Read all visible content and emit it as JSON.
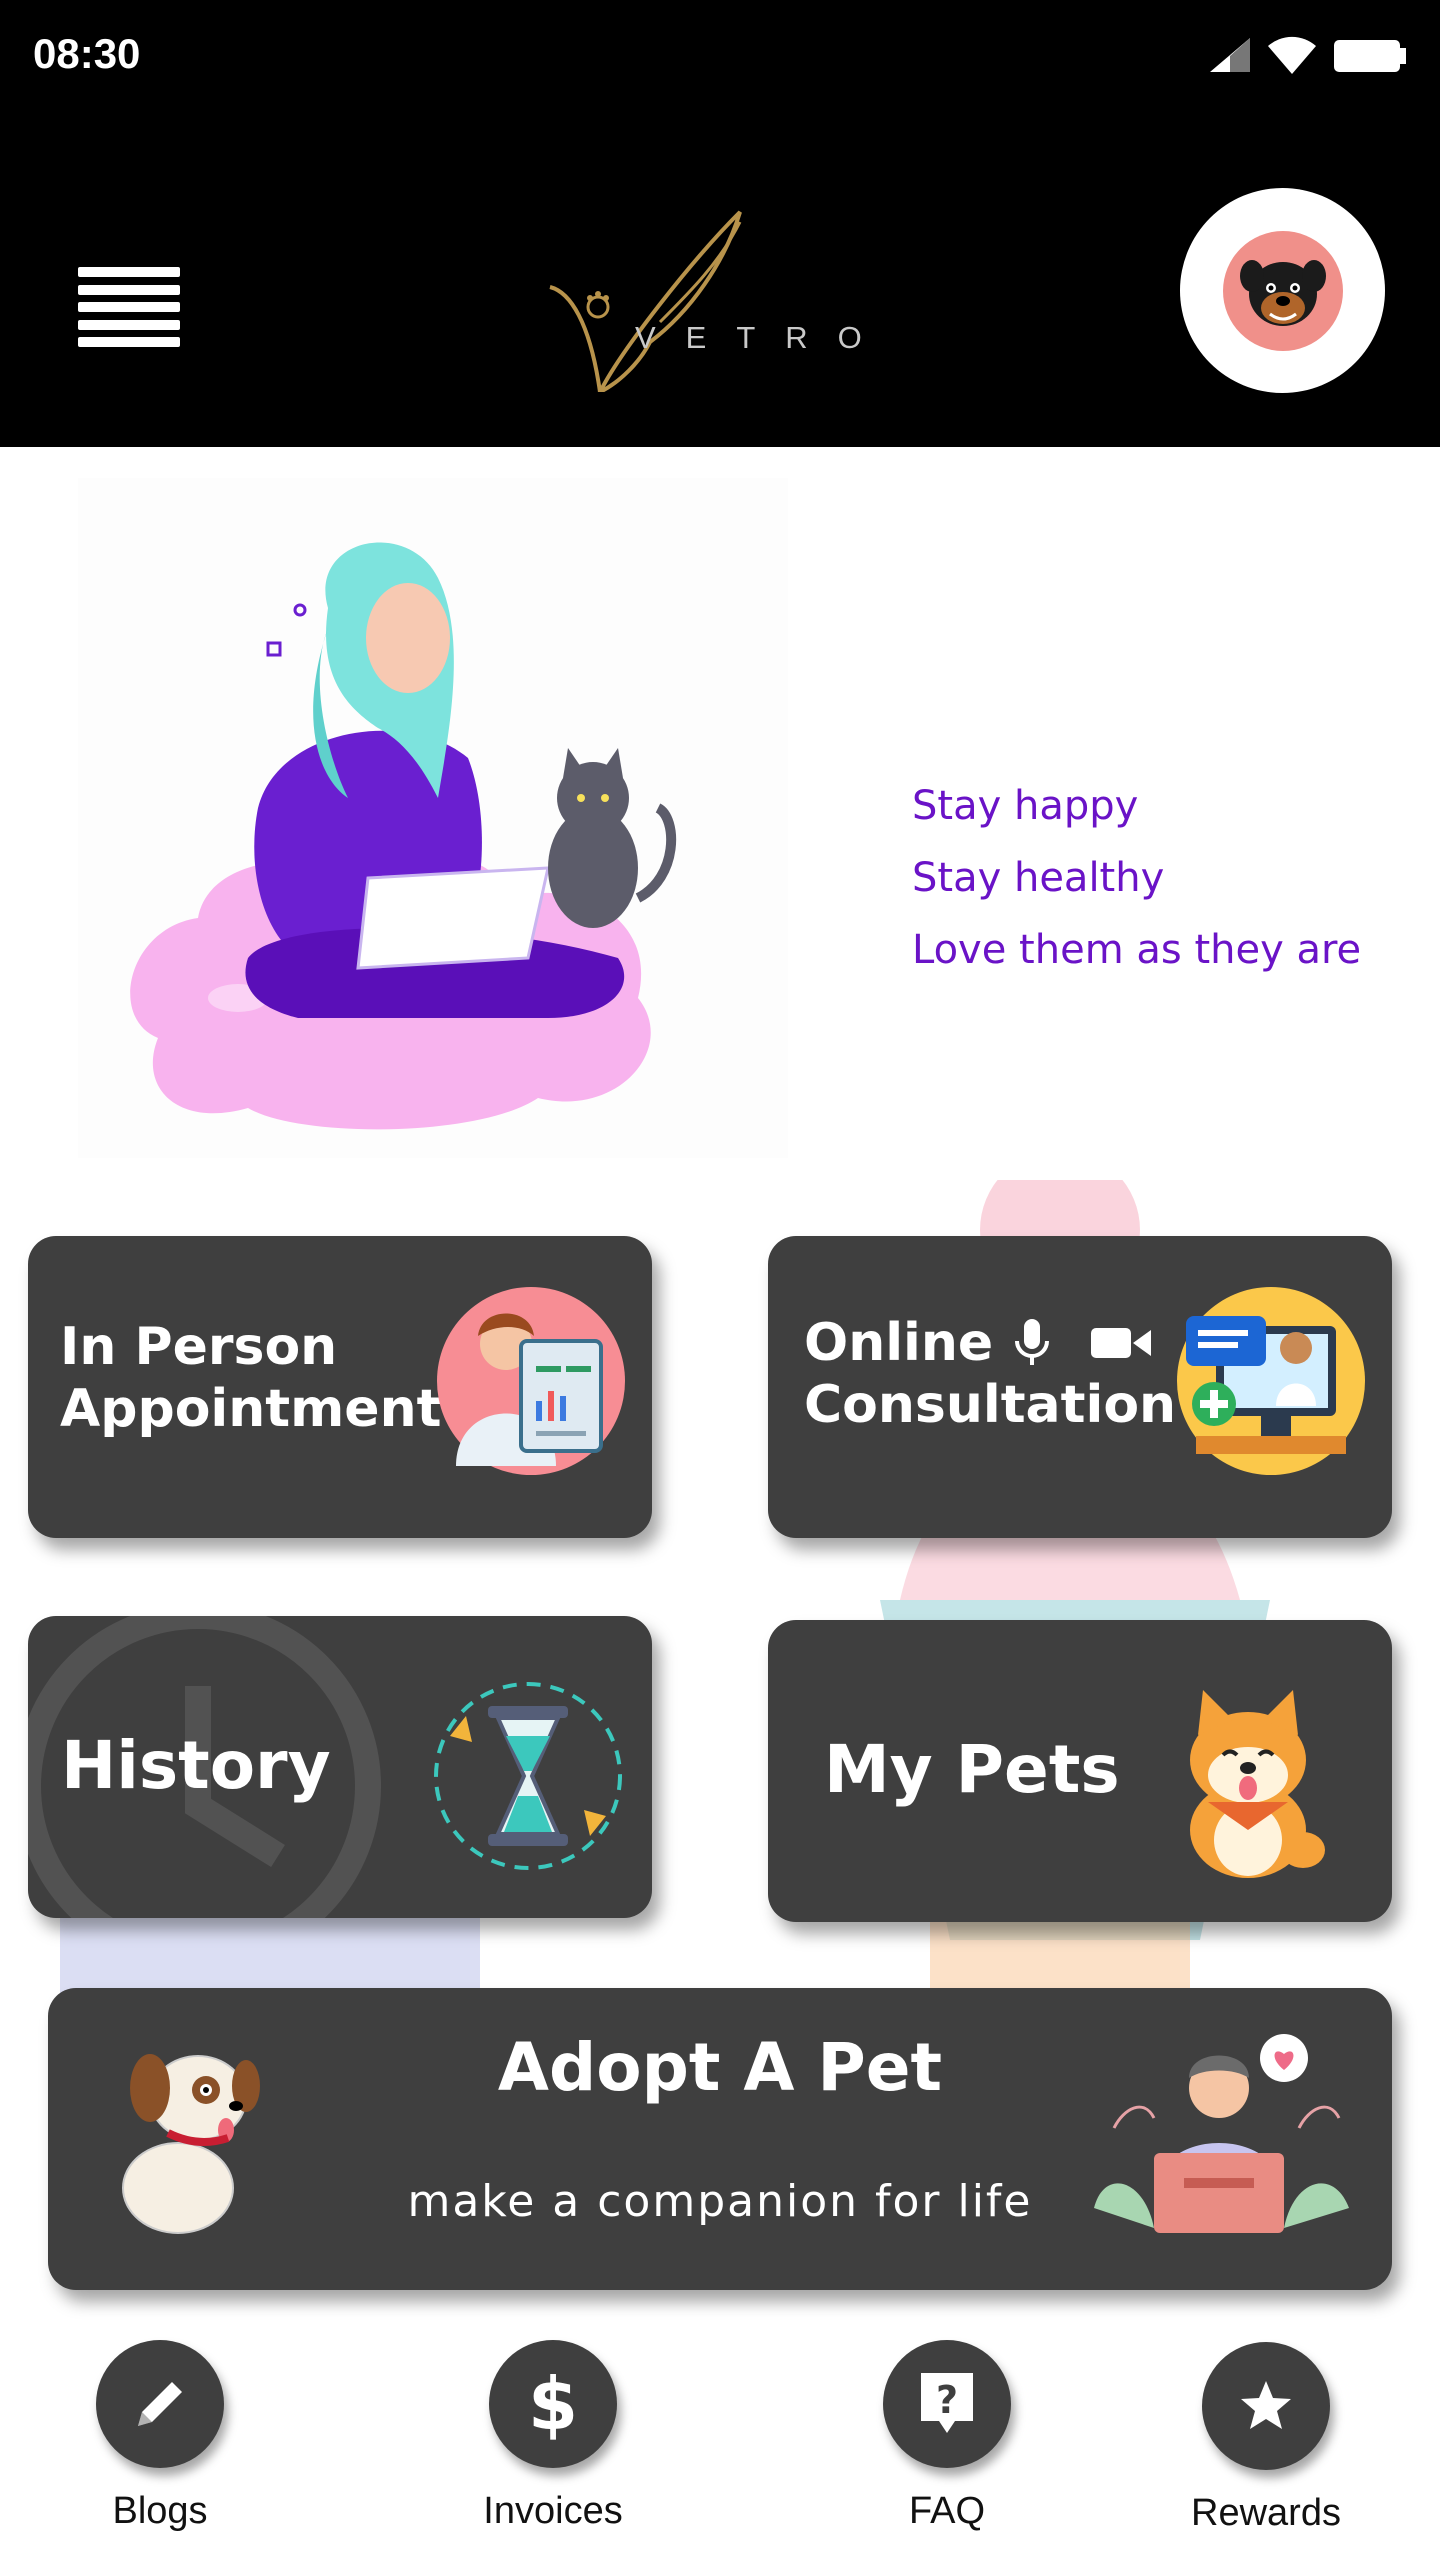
{
  "status": {
    "time": "08:30"
  },
  "header": {
    "logo_text": "VETRO"
  },
  "hero": {
    "tagline": [
      "Stay happy",
      "Stay healthy",
      "Love them as they are"
    ]
  },
  "cards": {
    "in_person": {
      "line1": "In Person",
      "line2": "Appointment"
    },
    "online": {
      "line1": "Online",
      "line2": "Consultation"
    },
    "history": {
      "label": "History"
    },
    "my_pets": {
      "label": "My Pets"
    },
    "adopt": {
      "title": "Adopt A Pet",
      "subtitle": "make a companion for life"
    }
  },
  "bottom_nav": [
    {
      "label": "Blogs",
      "icon": "pencil-icon"
    },
    {
      "label": "Invoices",
      "icon": "dollar-icon"
    },
    {
      "label": "FAQ",
      "icon": "question-icon"
    },
    {
      "label": "Rewards",
      "icon": "star-icon"
    }
  ],
  "colors": {
    "accent": "#6a13c7",
    "card": "#3f3f3f",
    "header": "#000000"
  }
}
